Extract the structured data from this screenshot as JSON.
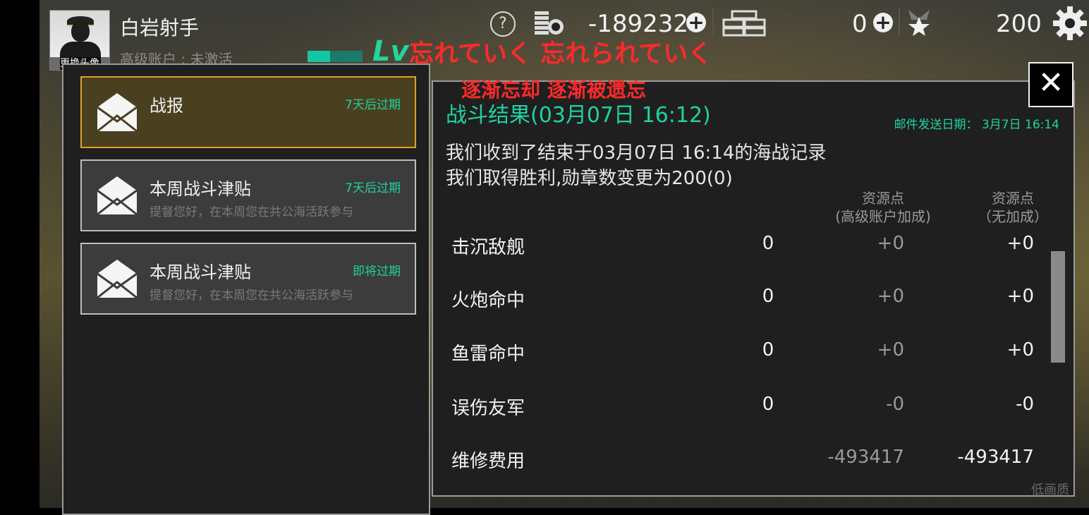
{
  "player": {
    "name": "白岩射手",
    "account_status": "高级账户 : 未激活",
    "avatar_caption": "更换头像",
    "level_label": "Lv"
  },
  "hud": {
    "currency": "-189232",
    "medals": "0",
    "score": "200"
  },
  "overlay": {
    "line1": "忘れていく 忘れられていく",
    "line2": "逐渐忘却 逐渐被遗忘"
  },
  "mail_list": [
    {
      "title": "战报",
      "expiry": "7天后过期",
      "preview": ""
    },
    {
      "title": "本周战斗津贴",
      "expiry": "7天后过期",
      "preview": "提督您好，在本周您在共公海活跃参与"
    },
    {
      "title": "本周战斗津贴",
      "expiry": "即将过期",
      "preview": "提督您好，在本周您在共公海活跃参与"
    }
  ],
  "report": {
    "title": "战斗结果(03月07日 16:12)",
    "send_date": "邮件发送日期： 3月7日 16:14",
    "message_line1": "我们收到了结束于03月07日 16:14的海战记录",
    "message_line2": "我们取得胜利,勋章数变更为200(0)",
    "col_premium_1": "资源点",
    "col_premium_2": "(高级账户加成)",
    "col_base_1": "资源点",
    "col_base_2": "（无加成）",
    "rows": [
      {
        "label": "击沉敌舰",
        "count": "0",
        "premium": "+0",
        "base": "+0"
      },
      {
        "label": "火炮命中",
        "count": "0",
        "premium": "+0",
        "base": "+0"
      },
      {
        "label": "鱼雷命中",
        "count": "0",
        "premium": "+0",
        "base": "+0"
      },
      {
        "label": "误伤友军",
        "count": "0",
        "premium": "-0",
        "base": "-0"
      },
      {
        "label": "维修费用",
        "count": "",
        "premium": "-493417",
        "base": "-493417"
      }
    ]
  },
  "footer": {
    "quality": "低画质"
  },
  "colors": {
    "accent_green": "#1ed3a1",
    "selected_border": "#e0a02a",
    "overlay_red": "#ff2a2a"
  }
}
